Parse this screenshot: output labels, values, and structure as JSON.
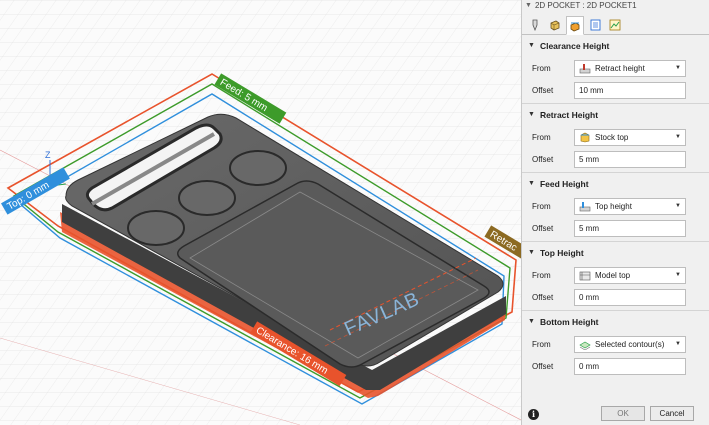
{
  "viewport": {
    "labels": {
      "feed": "Feed: 5 mm",
      "top": "Top: 0 mm",
      "retract": "Retrac",
      "clearance": "Clearance: 16 mm",
      "engraving": "FAVLAB"
    },
    "colors": {
      "clearance": "#e8532c",
      "feed": "#3d9b2a",
      "top": "#2f8fdc",
      "retract": "#8c6a22",
      "part": "#5d5d5d"
    },
    "axis": {
      "z": "Z"
    }
  },
  "panel": {
    "title": "2D POCKET : 2D POCKET1",
    "tabs": [
      {
        "icon": "tool-icon"
      },
      {
        "icon": "geometry-icon"
      },
      {
        "icon": "heights-icon",
        "active": true
      },
      {
        "icon": "passes-icon"
      },
      {
        "icon": "linking-icon"
      }
    ],
    "sections": [
      {
        "title": "Clearance Height",
        "from_label": "From",
        "from_value": "Retract height",
        "offset_label": "Offset",
        "offset_value": "10 mm",
        "icon": "retract-height-icon"
      },
      {
        "title": "Retract Height",
        "from_label": "From",
        "from_value": "Stock top",
        "offset_label": "Offset",
        "offset_value": "5 mm",
        "icon": "stock-top-icon"
      },
      {
        "title": "Feed Height",
        "from_label": "From",
        "from_value": "Top height",
        "offset_label": "Offset",
        "offset_value": "5 mm",
        "icon": "top-height-icon"
      },
      {
        "title": "Top Height",
        "from_label": "From",
        "from_value": "Model top",
        "offset_label": "Offset",
        "offset_value": "0 mm",
        "icon": "model-top-icon"
      },
      {
        "title": "Bottom Height",
        "from_label": "From",
        "from_value": "Selected contour(s)",
        "offset_label": "Offset",
        "offset_value": "0 mm",
        "icon": "selected-contours-icon"
      }
    ],
    "footer": {
      "info": "i",
      "ok": "OK",
      "cancel": "Cancel"
    }
  }
}
